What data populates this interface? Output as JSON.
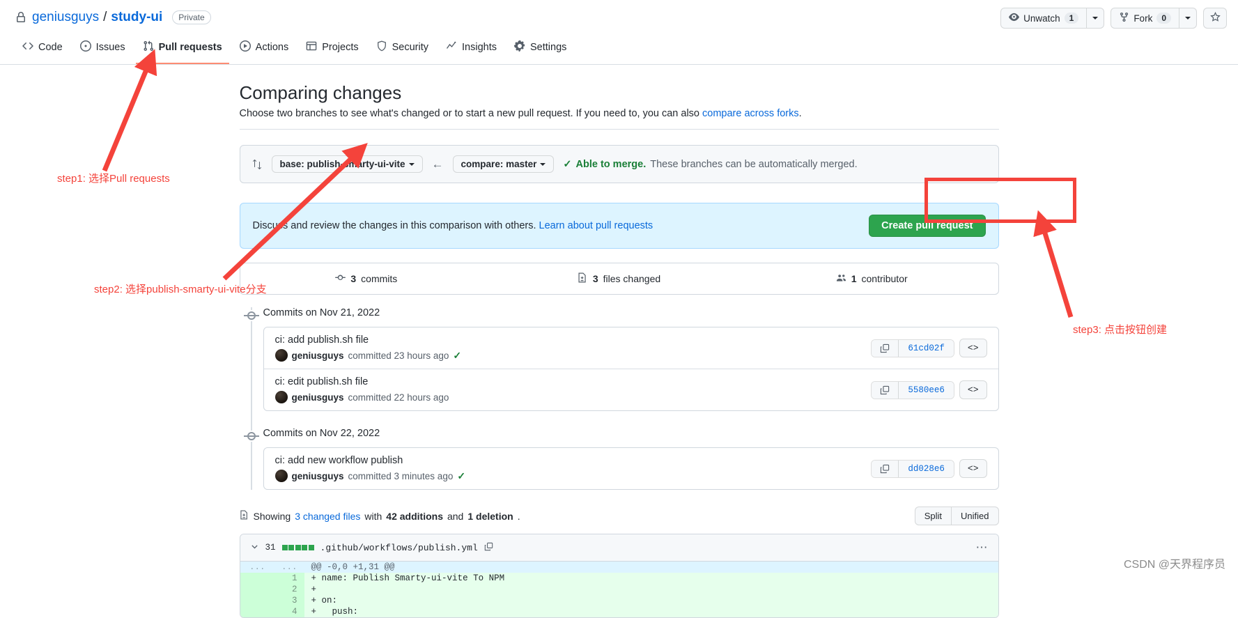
{
  "repo": {
    "owner": "geniusguys",
    "name": "study-ui",
    "separator": "/",
    "visibility": "Private",
    "lock_icon": "lock-icon"
  },
  "header_actions": {
    "watch_label": "Unwatch",
    "watch_count": "1",
    "fork_label": "Fork",
    "fork_count": "0",
    "star_icon": "star-icon"
  },
  "nav": {
    "items": [
      {
        "label": "Code",
        "icon": "code-icon",
        "selected": false
      },
      {
        "label": "Issues",
        "icon": "issue-opened-icon",
        "selected": false
      },
      {
        "label": "Pull requests",
        "icon": "git-pull-request-icon",
        "selected": true
      },
      {
        "label": "Actions",
        "icon": "play-icon",
        "selected": false
      },
      {
        "label": "Projects",
        "icon": "table-icon",
        "selected": false
      },
      {
        "label": "Security",
        "icon": "shield-icon",
        "selected": false
      },
      {
        "label": "Insights",
        "icon": "graph-icon",
        "selected": false
      },
      {
        "label": "Settings",
        "icon": "gear-icon",
        "selected": false
      }
    ]
  },
  "page": {
    "title": "Comparing changes",
    "subtitle_pre": "Choose two branches to see what's changed or to start a new pull request. If you need to, you can also ",
    "subtitle_link": "compare across forks",
    "subtitle_post": "."
  },
  "range": {
    "swap_icon": "swap-icon",
    "base_label": "base: publish-smarty-ui-vite",
    "arrow_icon": "arrow-left-icon",
    "compare_label": "compare: master",
    "merge_status_strong": "Able to merge.",
    "merge_status_rest": "These branches can be automatically merged."
  },
  "discuss": {
    "text_pre": "Discuss and review the changes in this comparison with others. ",
    "link": "Learn about pull requests",
    "create_button": "Create pull request"
  },
  "stats": [
    {
      "icon": "commit-icon",
      "count": "3",
      "label": "commits"
    },
    {
      "icon": "file-diff-icon",
      "count": "3",
      "label": "files changed"
    },
    {
      "icon": "people-icon",
      "count": "1",
      "label": "contributor"
    }
  ],
  "commit_groups": [
    {
      "date_title": "Commits on Nov 21, 2022",
      "commits": [
        {
          "message": "ci: add publish.sh file",
          "author": "geniusguys",
          "meta": "committed 23 hours ago",
          "has_check": true,
          "sha": "61cd02f",
          "copy_icon": "copy-icon",
          "code_icon": "code-brackets-icon"
        },
        {
          "message": "ci: edit publish.sh file",
          "author": "geniusguys",
          "meta": "committed 22 hours ago",
          "has_check": false,
          "sha": "5580ee6",
          "copy_icon": "copy-icon",
          "code_icon": "code-brackets-icon"
        }
      ]
    },
    {
      "date_title": "Commits on Nov 22, 2022",
      "commits": [
        {
          "message": "ci: add new workflow publish",
          "author": "geniusguys",
          "meta": "committed 3 minutes ago",
          "has_check": true,
          "sha": "dd028e6",
          "copy_icon": "copy-icon",
          "code_icon": "code-brackets-icon"
        }
      ]
    }
  ],
  "files_summary": {
    "icon": "file-diff-icon",
    "pre": "Showing ",
    "link": "3 changed files",
    "mid": " with ",
    "additions": "42 additions",
    "and": " and ",
    "deletions": "1 deletion",
    "end": ".",
    "split_label": "Split",
    "unified_label": "Unified"
  },
  "diff": {
    "chevron_icon": "chevron-down-icon",
    "change_count": "31",
    "filename": ".github/workflows/publish.yml",
    "copy_path_icon": "copy-icon",
    "more_icon": "kebab-horizontal-icon",
    "hunk_header": "@@ -0,0 +1,31 @@",
    "hunk_ln_left": "...",
    "hunk_ln_right": "...",
    "lines": [
      {
        "num": "1",
        "marker": "+",
        "code": "name: Publish Smarty-ui-vite To NPM"
      },
      {
        "num": "2",
        "marker": "+",
        "code": ""
      },
      {
        "num": "3",
        "marker": "+",
        "code": "on:"
      },
      {
        "num": "4",
        "marker": "+",
        "code": "  push:"
      }
    ]
  },
  "annotations": {
    "color": "#f4433b",
    "step1": "step1: 选择Pull requests",
    "step2": "step2: 选择publish-smarty-ui-vite分支",
    "step3": "step3: 点击按钮创建"
  },
  "watermark": "CSDN @天界程序员"
}
